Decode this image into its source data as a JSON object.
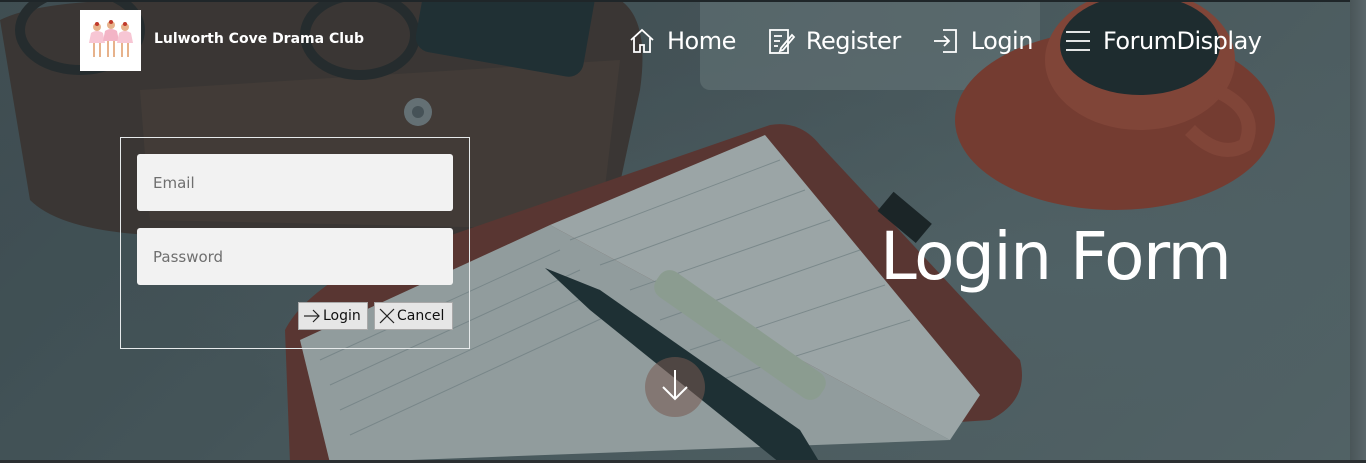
{
  "header": {
    "brand": "Lulworth Cove Drama Club",
    "logo_icon": "ballerinas-logo"
  },
  "nav": {
    "items": [
      {
        "label": "Home",
        "icon": "home-icon"
      },
      {
        "label": "Register",
        "icon": "edit-icon"
      },
      {
        "label": "Login",
        "icon": "login-icon"
      },
      {
        "label": "ForumDisplay",
        "icon": "menu-icon"
      }
    ]
  },
  "form": {
    "email_placeholder": "Email",
    "password_placeholder": "Password",
    "login_label": "Login",
    "cancel_label": "Cancel"
  },
  "hero": {
    "title": "Login Form",
    "scroll_icon": "arrow-down-icon"
  },
  "colors": {
    "overlay": "#1c3037",
    "text": "#ffffff",
    "field_bg": "#f2f2f2",
    "button_bg": "#e6e6e6"
  }
}
